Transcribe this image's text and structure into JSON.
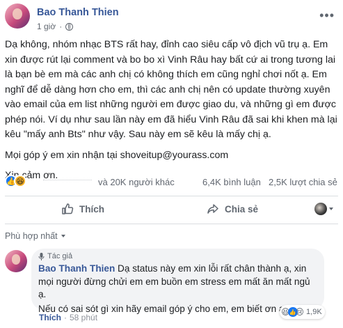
{
  "post": {
    "author": "Bao Thanh Thien",
    "time": "1 giờ",
    "time_sep": "·",
    "paragraphs": [
      "Dạ không, nhóm nhạc BTS rất hay, đỉnh cao siêu cấp vô địch vũ trụ ạ. Em xin được rút lại comment và bo bo xì Vinh Râu hay bất cứ ai trong tương lai là bạn bè em mà các anh chị có không thích em cũng nghỉ chơi nốt ạ. Em nghĩ để dễ dàng hơn cho em, thì các anh chị nên có update thường xuyên vào email của em list những người em được giao du, và những gì em được phép nói. Ví dụ như sau lần này em đã hiểu Vinh Râu đã sai khi khen mà lại kêu \"mấy anh Bts\" như vậy. Sau này em sẽ kêu là mấy chị ạ.",
      "Mọi góp ý em xin nhận tại shoveitup@yourass.com",
      "Xin cảm ơn."
    ]
  },
  "stats": {
    "others": "và 20K người khác",
    "comments": "6,4K bình luận",
    "shares": "2,5K lượt chia sẻ"
  },
  "actions": {
    "like": "Thích",
    "share": "Chia sẻ"
  },
  "sort": {
    "label": "Phù hợp nhất"
  },
  "comment": {
    "badge": "Tác giả",
    "author": "Bao Thanh Thien",
    "text1": "Dạ status này em xin lỗi rất chân thành ạ, xin mọi người đừng chửi em em buồn em stress em mất ăn mất ngủ ạ.",
    "text2": "Nếu có sai sót gì xin hãy email góp ý cho em, em biết ơn ạ.",
    "reaction_count": "1,9K",
    "like": "Thích",
    "sep": "·",
    "time": "58 phút"
  },
  "colors": {
    "link": "#385898",
    "like_blue": "#1877f2",
    "haha_yellow": "#f7b125",
    "divider": "#dadde1",
    "bubble": "#f2f3f5"
  }
}
